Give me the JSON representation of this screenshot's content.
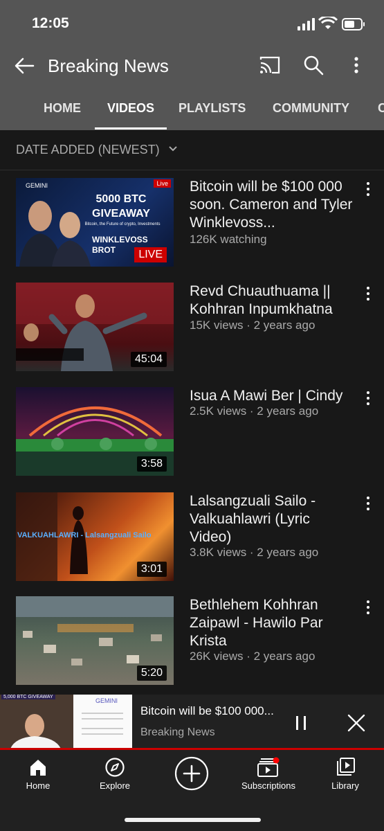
{
  "status_bar": {
    "time": "12:05"
  },
  "header": {
    "title": "Breaking News",
    "tabs": [
      "HOME",
      "VIDEOS",
      "PLAYLISTS",
      "COMMUNITY",
      "C"
    ],
    "active_tab": "VIDEOS"
  },
  "sort": {
    "label": "DATE ADDED (NEWEST)"
  },
  "videos": [
    {
      "title": "Bitcoin will be $100 000 soon. Cameron and Tyler Winklevoss...",
      "meta": "126K watching",
      "badge": "LIVE",
      "thumb_text": {
        "brand": "GEMINI",
        "corner": "Live",
        "headline": "5000 BTC GIVEAWAY",
        "sub": "Bitcoin, the Future of crypto, Investments",
        "names": "WINKLEVOSS BROT"
      }
    },
    {
      "title": "Revd Chuauthuama || Kohhran Inpumkhatna",
      "meta": "15K views · 2 years ago",
      "duration": "45:04"
    },
    {
      "title": "Isua A Mawi Ber | Cindy",
      "meta": "2.5K views · 2 years ago",
      "duration": "3:58"
    },
    {
      "title": "Lalsangzuali Sailo - Valkuahlawri (Lyric Video)",
      "meta": "3.8K views · 2 years ago",
      "duration": "3:01",
      "thumb_text": {
        "caption": "VALKUAHLAWRI - Lalsangzuali Sailo"
      }
    },
    {
      "title": "Bethlehem Kohhran Zaipawl - Hawilo Par Krista",
      "meta": "26K views · 2 years ago",
      "duration": "5:20"
    }
  ],
  "mini_player": {
    "title": "Bitcoin will be $100 000...",
    "channel": "Breaking News",
    "thumb_text": {
      "banner": "5,000 BTC GIVEAWAY",
      "brand": "GEMINI"
    }
  },
  "bottom_nav": [
    "Home",
    "Explore",
    "",
    "Subscriptions",
    "Library"
  ],
  "colors": {
    "header": "#555555",
    "background": "#181818",
    "accent": "#cc0000",
    "nav": "#212121"
  }
}
